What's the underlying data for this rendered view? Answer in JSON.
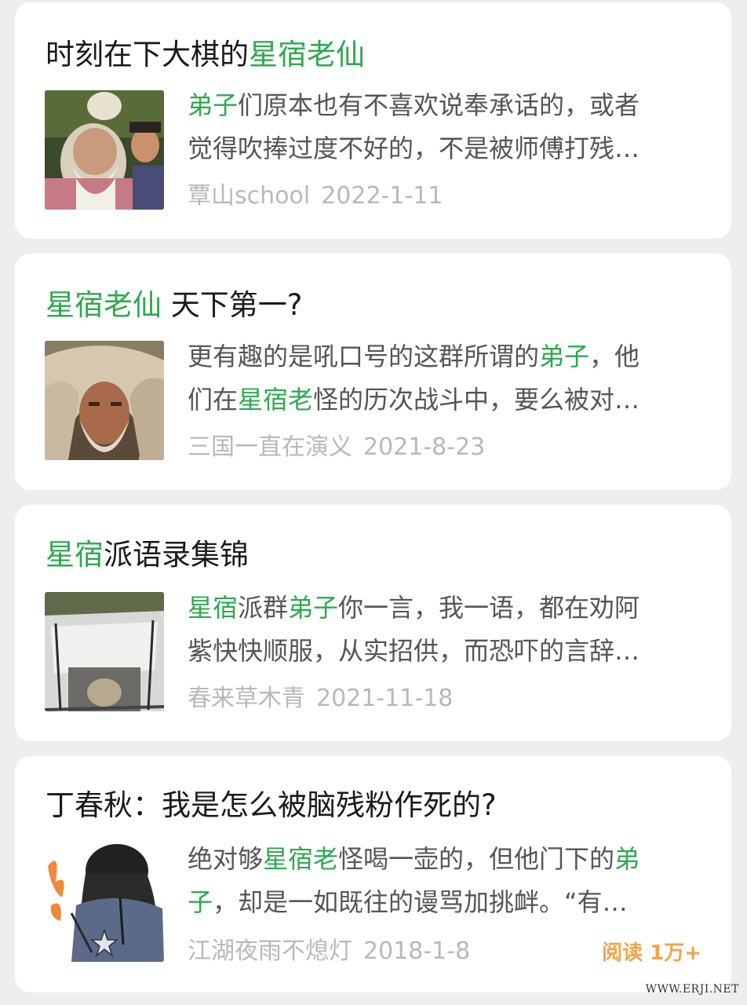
{
  "articles": [
    {
      "title_pre": "时刻在下大棋的",
      "title_hl": "星宿老仙",
      "title_post": "",
      "line1_hl": "弟子",
      "line1_rest": "们原本也有不喜欢说奉承话的，或者",
      "line2": "觉得吹捧过度不好的，不是被师傅打残…",
      "author": "覃山school",
      "date": "2022-1-11"
    },
    {
      "title_pre": "",
      "title_hl": "星宿老仙",
      "title_post": " 天下第一?",
      "line1_pre": "更有趣的是吼口号的这群所谓的",
      "line1_hl": "弟子",
      "line1_post": "，他",
      "line2_pre": "们在",
      "line2_hl": "星宿老",
      "line2_post": "怪的历次战斗中，要么被对…",
      "author": "三国一直在演义",
      "date": "2021-8-23"
    },
    {
      "title_hl": "星宿",
      "title_post": "派语录集锦",
      "line1_hl1": "星宿",
      "line1_mid": "派群",
      "line1_hl2": "弟子",
      "line1_post": "你一言，我一语，都在劝阿",
      "line2": "紫快快顺服，从实招供，而恐吓的言辞…",
      "author": "春来草木青",
      "date": "2021-11-18"
    },
    {
      "title": "丁春秋：我是怎么被脑残粉作死的?",
      "line1_pre": "绝对够",
      "line1_hl": "星宿老",
      "line1_mid": "怪喝一壶的，但他门下的",
      "line1_hl2": "弟",
      "line2_hl": "子",
      "line2_post": "，却是一如既往的谩骂加挑衅。“有…",
      "author": "江湖夜雨不熄灯",
      "date": "2018-1-8",
      "read_count": "阅读 1万+"
    }
  ],
  "watermark": "WWW.ERJI.NET",
  "colors": {
    "highlight": "#2fa84f",
    "read_count": "#f0a44b",
    "meta": "#b8b8b8",
    "background": "#eeeeee",
    "card": "#ffffff"
  }
}
